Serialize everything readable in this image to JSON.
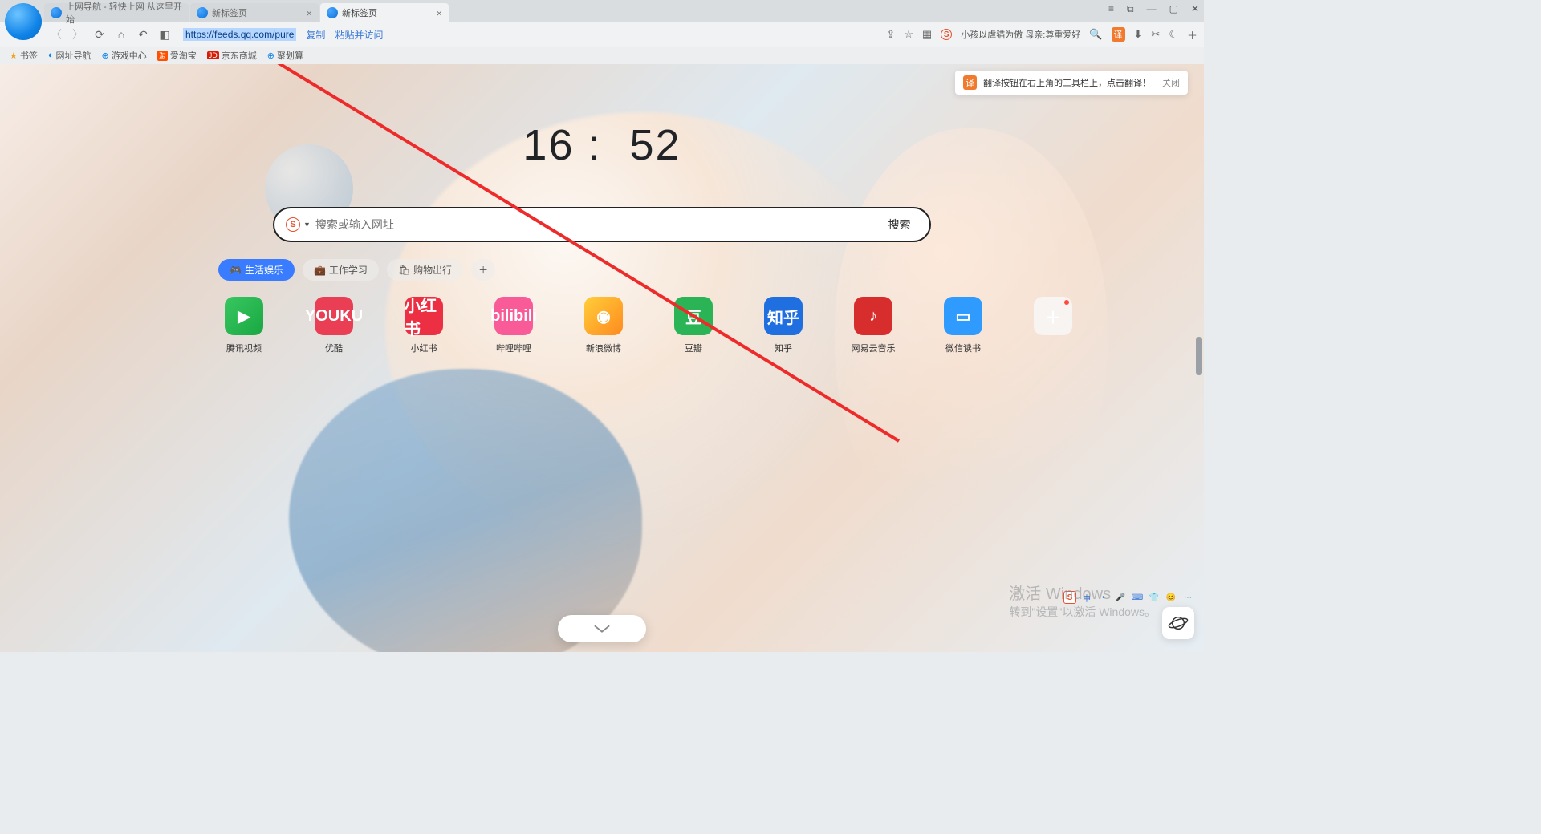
{
  "tabs": [
    {
      "title": "上网导航 - 轻快上网 从这里开始"
    },
    {
      "title": "新标签页"
    },
    {
      "title": "新标签页"
    }
  ],
  "window_controls": {
    "menu": "≡",
    "pip": "⧉",
    "min": "—",
    "max": "▢",
    "close": "✕"
  },
  "nav": {
    "url_selected": "https://feeds.qq.com/pure",
    "copy": "复制",
    "paste_go": "粘贴并访问",
    "hotword": "小孩以虐猫为傲 母亲:尊重爱好"
  },
  "bookmarks": {
    "label": "书签",
    "items": [
      "网址导航",
      "游戏中心",
      "爱淘宝",
      "京东商城",
      "聚划算"
    ]
  },
  "clock": {
    "h": "16",
    "m": "52"
  },
  "search": {
    "placeholder": "搜索或输入网址",
    "button": "搜索",
    "engine_letter": "S"
  },
  "cats": [
    {
      "icon": "🎮",
      "label": "生活娱乐",
      "active": true
    },
    {
      "icon": "💼",
      "label": "工作学习",
      "active": false
    },
    {
      "icon": "🛍",
      "label": "购物出行",
      "active": false
    }
  ],
  "tiles": [
    {
      "label": "腾讯视频",
      "glyph": "▶",
      "cls": "t-tx"
    },
    {
      "label": "优酷",
      "glyph": "YOUKU",
      "cls": "t-yk"
    },
    {
      "label": "小红书",
      "glyph": "小红书",
      "cls": "t-xhs"
    },
    {
      "label": "哔哩哔哩",
      "glyph": "bilibili",
      "cls": "t-bili"
    },
    {
      "label": "新浪微博",
      "glyph": "◉",
      "cls": "t-weibo"
    },
    {
      "label": "豆瓣",
      "glyph": "豆",
      "cls": "t-douban"
    },
    {
      "label": "知乎",
      "glyph": "知乎",
      "cls": "t-zhihu"
    },
    {
      "label": "网易云音乐",
      "glyph": "♪",
      "cls": "t-netease"
    },
    {
      "label": "微信读书",
      "glyph": "▭",
      "cls": "t-wxread"
    }
  ],
  "tile_add_glyph": "＋",
  "tip": {
    "badge": "译",
    "text": "翻译按钮在右上角的工具栏上，点击翻译！",
    "close": "关闭"
  },
  "watermark": {
    "l1": "激活 Windows",
    "l2": "转到\"设置\"以激活 Windows。"
  },
  "ime": [
    "S",
    "中",
    "",
    "🎤",
    "⌨",
    "👕",
    "😊",
    "⋯"
  ]
}
